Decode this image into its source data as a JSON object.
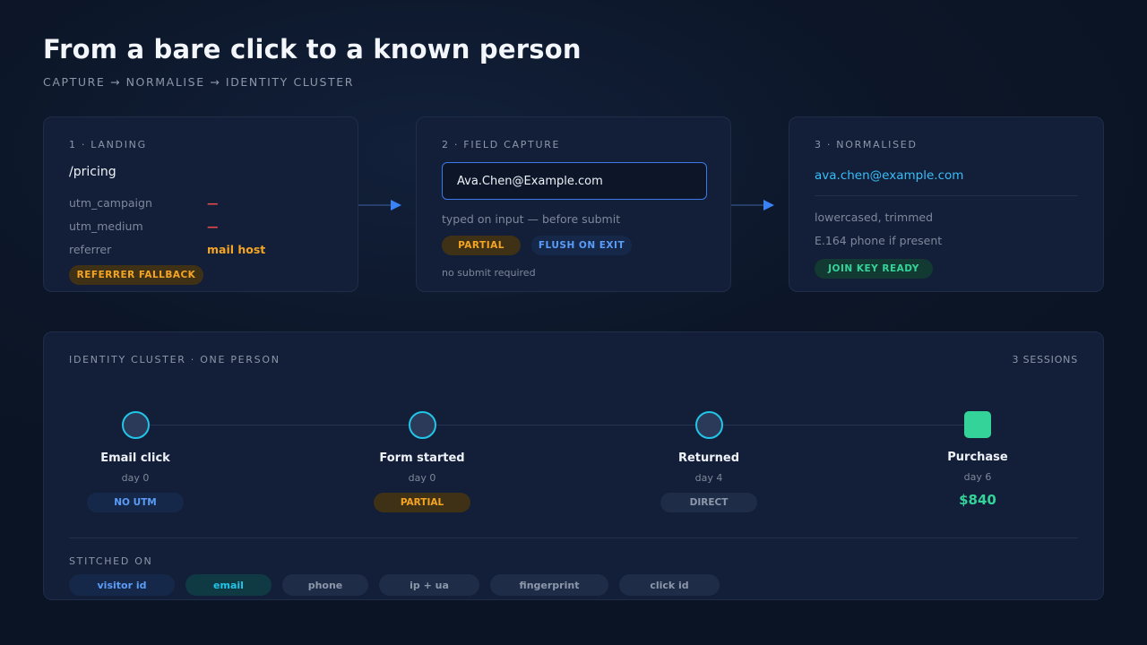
{
  "header": {
    "title": "From a bare click to a known person",
    "subtitle": "CAPTURE → NORMALISE → IDENTITY CLUSTER"
  },
  "cards": {
    "landing": {
      "label": "1 · LANDING",
      "path": "/pricing",
      "rows": [
        {
          "key": "utm_campaign",
          "value": "—"
        },
        {
          "key": "utm_medium",
          "value": "—"
        },
        {
          "key": "referrer",
          "value": "mail host"
        }
      ],
      "badge": "REFERRER FALLBACK"
    },
    "capture": {
      "label": "2 · FIELD CAPTURE",
      "input_value": "Ava.Chen@Example.com",
      "note": "typed on input — before submit",
      "badges": [
        "PARTIAL",
        "FLUSH ON EXIT"
      ],
      "footnote": "no submit required"
    },
    "normalised": {
      "label": "3 · NORMALISED",
      "email": "ava.chen@example.com",
      "notes": [
        "lowercased, trimmed",
        "E.164 phone if present"
      ],
      "badge": "JOIN KEY READY"
    }
  },
  "cluster": {
    "label": "IDENTITY CLUSTER · ONE PERSON",
    "sessions": "3 SESSIONS",
    "steps": [
      {
        "name": "Email click",
        "day": "day 0",
        "tag": "NO UTM"
      },
      {
        "name": "Form started",
        "day": "day 0",
        "tag": "PARTIAL"
      },
      {
        "name": "Returned",
        "day": "day 4",
        "tag": "DIRECT"
      },
      {
        "name": "Purchase",
        "day": "day 6",
        "amount": "$840"
      }
    ],
    "stitched_label": "STITCHED ON",
    "chips": [
      "visitor id",
      "email",
      "phone",
      "ip + ua",
      "fingerprint",
      "click id"
    ]
  },
  "colors": {
    "background": "#0c1628",
    "card": "#131f38",
    "accent_blue": "#3b82f6",
    "accent_cyan": "#22c5e8",
    "amber": "#f5a524",
    "green": "#34d399",
    "red": "#e5484d"
  }
}
